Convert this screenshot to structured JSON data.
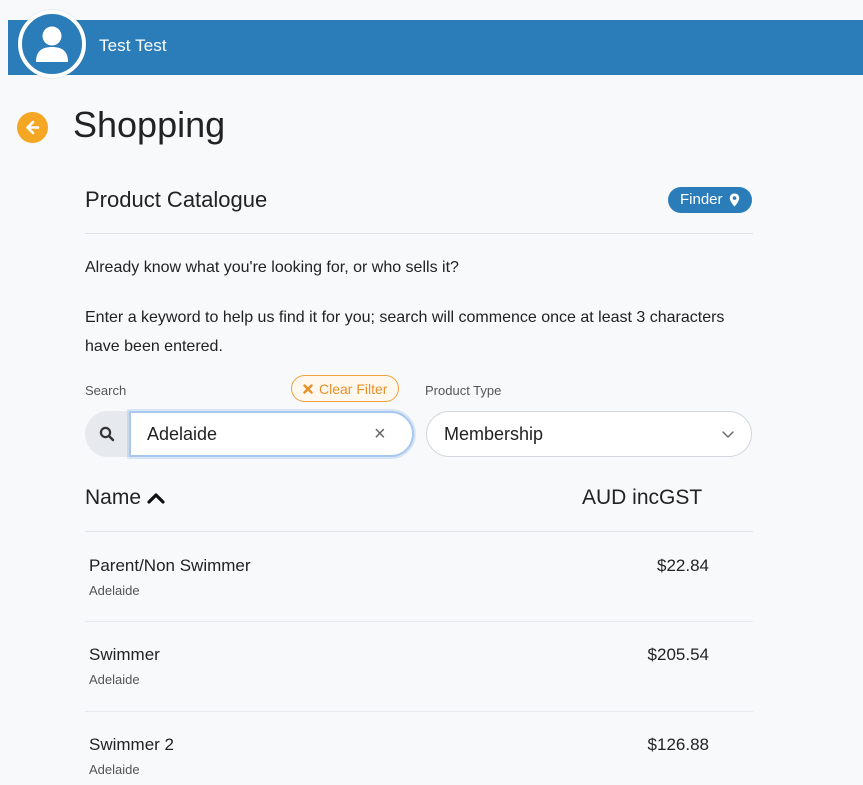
{
  "header": {
    "user_name": "Test Test"
  },
  "page": {
    "title": "Shopping"
  },
  "catalogue": {
    "title": "Product Catalogue",
    "finder_label": "Finder",
    "intro_question": "Already know what you're looking for, or who sells it?",
    "intro_instruction": "Enter a keyword to help us find it for you; search will commence once at least 3 characters have been entered."
  },
  "filters": {
    "search_label": "Search",
    "search_value": "Adelaide",
    "clear_filter_label": "Clear Filter",
    "product_type_label": "Product Type",
    "product_type_value": "Membership"
  },
  "table": {
    "col_name": "Name",
    "col_price": "AUD incGST",
    "rows": [
      {
        "name": "Parent/Non Swimmer",
        "location": "Adelaide",
        "price": "$22.84"
      },
      {
        "name": "Swimmer",
        "location": "Adelaide",
        "price": "$205.54"
      },
      {
        "name": "Swimmer 2",
        "location": "Adelaide",
        "price": "$126.88"
      }
    ]
  },
  "colors": {
    "brand_blue": "#2b7db9",
    "accent_orange": "#f5a623"
  }
}
